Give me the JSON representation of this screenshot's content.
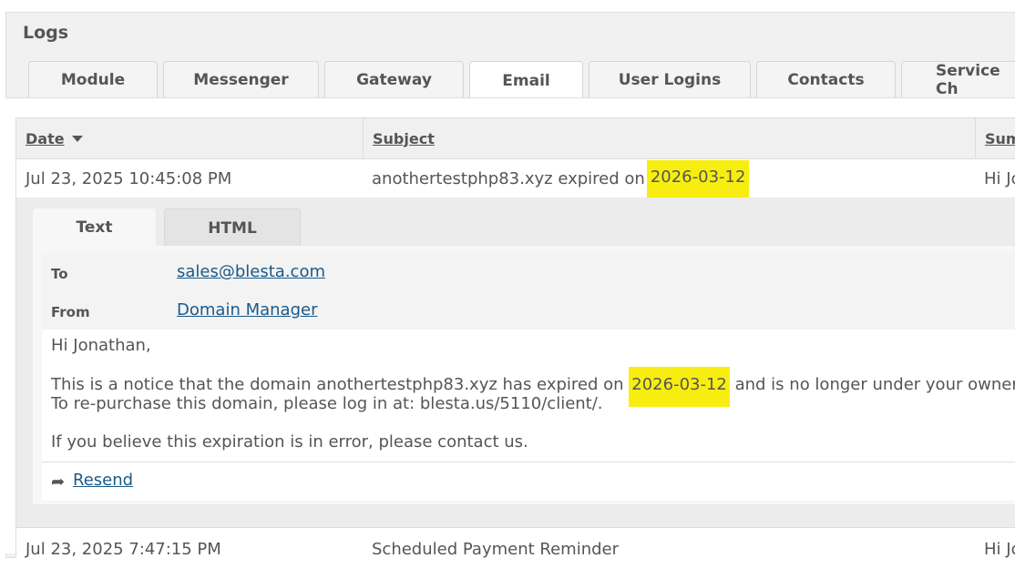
{
  "panel": {
    "title": "Logs"
  },
  "tabs": [
    {
      "label": "Module"
    },
    {
      "label": "Messenger"
    },
    {
      "label": "Gateway"
    },
    {
      "label": "Email",
      "active": true
    },
    {
      "label": "User Logins"
    },
    {
      "label": "Contacts"
    },
    {
      "label": "Service Ch"
    }
  ],
  "table": {
    "headers": {
      "date": "Date",
      "subject": "Subject",
      "summary": "Sum"
    },
    "rows": [
      {
        "date": "Jul 23, 2025 10:45:08 PM",
        "subject_prefix": "anothertestphp83.xyz expired on ",
        "subject_date": "2026-03-12",
        "summary": "Hi Jo"
      },
      {
        "date": "Jul 23, 2025 7:47:15 PM",
        "subject_prefix": "Scheduled Payment Reminder",
        "subject_date": "",
        "summary": "Hi Jo"
      }
    ]
  },
  "detail": {
    "tabs": {
      "text": "Text",
      "html": "HTML"
    },
    "to_label": "To",
    "to_value": "sales@blesta.com",
    "from_label": "From",
    "from_value": "Domain Manager",
    "body": {
      "greeting": "Hi Jonathan,",
      "line1_prefix": "This is a notice that the domain anothertestphp83.xyz has expired on ",
      "line1_date": "2026-03-12",
      "line1_suffix": " and is no longer under your ownership.",
      "line2": "To re-purchase this domain, please log in at: blesta.us/5110/client/.",
      "line3": "If you believe this expiration is in error, please contact us."
    },
    "resend_label": "Resend"
  },
  "colors": {
    "highlight": "#f7ee10",
    "link": "#1a5a8a"
  }
}
